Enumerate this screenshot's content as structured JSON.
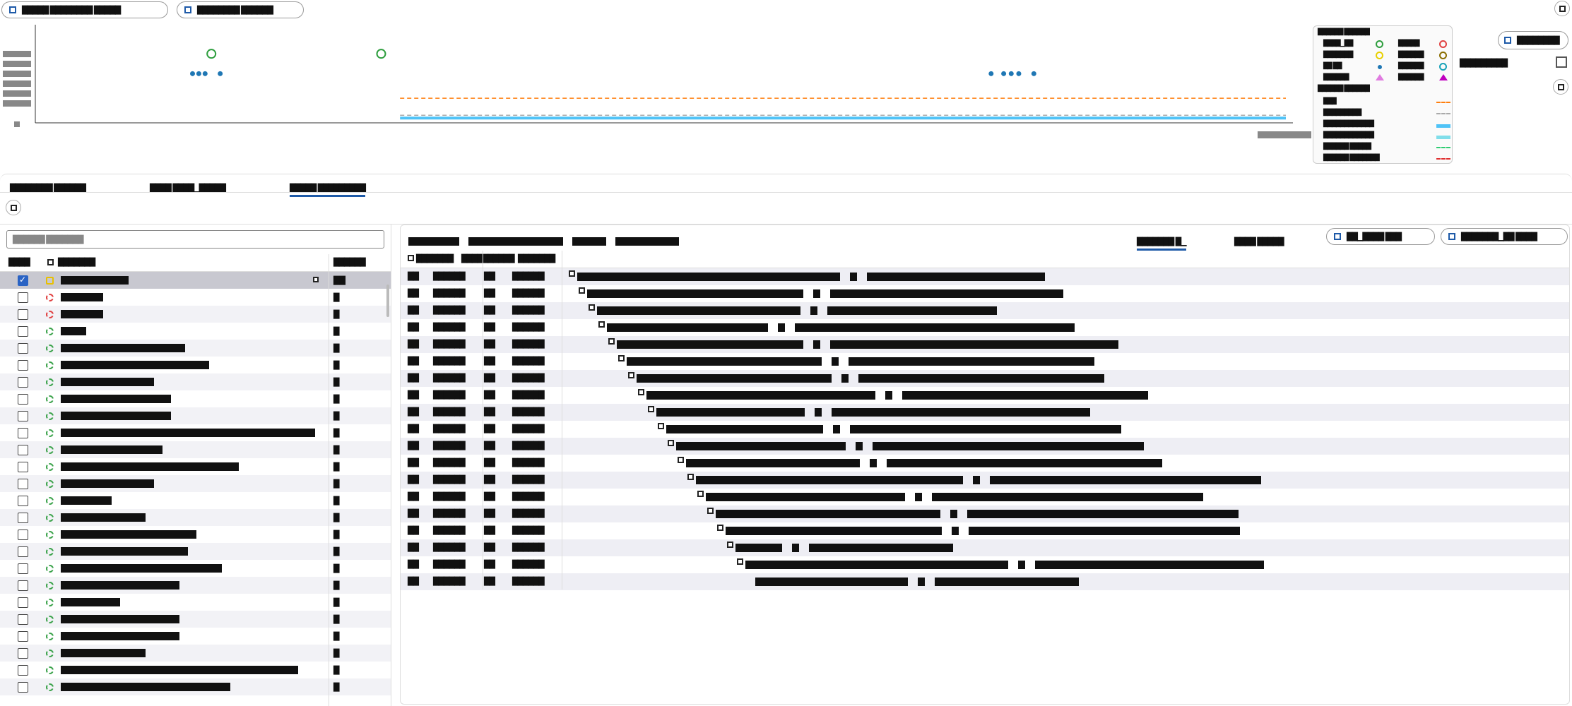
{
  "toolbar": {
    "left_pills": [
      {
        "label": "█████ ████████ █████"
      },
      {
        "label": "████████ ██████"
      }
    ],
    "right_pill": "████████",
    "select_value": "█████████"
  },
  "chart_data": {
    "type": "line",
    "xlabel": "",
    "ylabel": "",
    "ylim": [
      0,
      10
    ],
    "xlim": [
      0,
      100
    ],
    "grid": false,
    "legend_position": "right",
    "baseline_series": [
      {
        "name": "████",
        "style": "dashed",
        "color": "#ff7f0e",
        "values_flat": 2.6
      },
      {
        "name": "████████",
        "style": "dashed",
        "color": "#aaaaaa",
        "values_flat": 0.8
      },
      {
        "name": "████████",
        "style": "solid",
        "color": "#4fc3f7",
        "values_flat": 0.5
      }
    ],
    "markers": [
      {
        "x": 14,
        "y": 7.3,
        "shape": "circle-open",
        "color": "#2e9e3e"
      },
      {
        "x": 27.5,
        "y": 7.3,
        "shape": "circle-open",
        "color": "#2e9e3e"
      },
      {
        "x": 12.5,
        "y": 5.2,
        "shape": "dot",
        "color": "#1f77b4"
      },
      {
        "x": 13.0,
        "y": 5.2,
        "shape": "dot",
        "color": "#1f77b4"
      },
      {
        "x": 13.5,
        "y": 5.2,
        "shape": "dot",
        "color": "#1f77b4"
      },
      {
        "x": 14.7,
        "y": 5.2,
        "shape": "dot",
        "color": "#1f77b4"
      },
      {
        "x": 76.0,
        "y": 5.2,
        "shape": "dot",
        "color": "#1f77b4"
      },
      {
        "x": 77.0,
        "y": 5.2,
        "shape": "dot",
        "color": "#1f77b4"
      },
      {
        "x": 77.6,
        "y": 5.2,
        "shape": "dot",
        "color": "#1f77b4"
      },
      {
        "x": 78.2,
        "y": 5.2,
        "shape": "dot",
        "color": "#1f77b4"
      },
      {
        "x": 79.4,
        "y": 5.2,
        "shape": "dot",
        "color": "#1f77b4"
      }
    ]
  },
  "legend": {
    "title": "██████ ██████",
    "marker_rows": [
      {
        "a": "████▁██",
        "a_color": "#2e9e3e",
        "a_shape": "circle",
        "b": "█████",
        "b_color": "#e04040",
        "b_shape": "circle"
      },
      {
        "a": "███████",
        "a_color": "#e8d000",
        "a_shape": "circle",
        "b": "██████",
        "b_color": "#8b6d00",
        "b_shape": "circle"
      },
      {
        "a": "██ ██",
        "a_color": "#1f77b4",
        "a_shape": "dot",
        "b": "██████",
        "b_color": "#17a2b8",
        "b_shape": "circle"
      },
      {
        "a": "██████",
        "a_color": "#e07be0",
        "a_shape": "triangle",
        "b": "██████",
        "b_color": "#c000c0",
        "b_shape": "triangle"
      }
    ],
    "line_title": "██████ ██████",
    "line_rows": [
      {
        "label": "███",
        "color": "#ff7f0e",
        "dash": true
      },
      {
        "label": "█████████",
        "color": "#aaaaaa",
        "dash": true
      },
      {
        "label": "████████████",
        "color": "#4fc3f7",
        "dash": false,
        "thick": true
      },
      {
        "label": "████████████",
        "color": "#80deea",
        "dash": false,
        "thick": true
      },
      {
        "label": "██████ █████",
        "color": "#2ecc71",
        "dash": true
      },
      {
        "label": "██████ ███████",
        "color": "#e03030",
        "dash": true
      }
    ]
  },
  "tabs": [
    {
      "label": "████████ ██████",
      "active": false
    },
    {
      "label": "████ ████▁█████",
      "active": false
    },
    {
      "label": "█████ █████████",
      "active": true
    }
  ],
  "left": {
    "search_placeholder": "██████ ███████",
    "headers": [
      "████",
      "███████",
      "██████"
    ],
    "rows": [
      {
        "checked": true,
        "status": "yellow",
        "name_w": 96,
        "val": "██",
        "selected": true
      },
      {
        "checked": false,
        "status": "red",
        "name_w": 60,
        "val": "█"
      },
      {
        "checked": false,
        "status": "red",
        "name_w": 60,
        "val": "█"
      },
      {
        "checked": false,
        "status": "green",
        "name_w": 36,
        "val": "█"
      },
      {
        "checked": false,
        "status": "green",
        "name_w": 176,
        "val": "█"
      },
      {
        "checked": false,
        "status": "green",
        "name_w": 210,
        "val": "█"
      },
      {
        "checked": false,
        "status": "green",
        "name_w": 132,
        "val": "█"
      },
      {
        "checked": false,
        "status": "green",
        "name_w": 156,
        "val": "█"
      },
      {
        "checked": false,
        "status": "green",
        "name_w": 156,
        "val": "█"
      },
      {
        "checked": false,
        "status": "green",
        "name_w": 360,
        "val": "█"
      },
      {
        "checked": false,
        "status": "green",
        "name_w": 144,
        "val": "█"
      },
      {
        "checked": false,
        "status": "green",
        "name_w": 252,
        "val": "█"
      },
      {
        "checked": false,
        "status": "green",
        "name_w": 132,
        "val": "█"
      },
      {
        "checked": false,
        "status": "green",
        "name_w": 72,
        "val": "█"
      },
      {
        "checked": false,
        "status": "green",
        "name_w": 120,
        "val": "█"
      },
      {
        "checked": false,
        "status": "green",
        "name_w": 192,
        "val": "█"
      },
      {
        "checked": false,
        "status": "green",
        "name_w": 180,
        "val": "█"
      },
      {
        "checked": false,
        "status": "green",
        "name_w": 228,
        "val": "█"
      },
      {
        "checked": false,
        "status": "green",
        "name_w": 168,
        "val": "█"
      },
      {
        "checked": false,
        "status": "green",
        "name_w": 84,
        "val": "█"
      },
      {
        "checked": false,
        "status": "green",
        "name_w": 168,
        "val": "█"
      },
      {
        "checked": false,
        "status": "green",
        "name_w": 168,
        "val": "█"
      },
      {
        "checked": false,
        "status": "green",
        "name_w": 120,
        "val": "█"
      },
      {
        "checked": false,
        "status": "green",
        "name_w": 336,
        "val": "█"
      },
      {
        "checked": false,
        "status": "green",
        "name_w": 240,
        "val": "█"
      }
    ]
  },
  "right": {
    "tabs": [
      {
        "label": "███████ █▁",
        "active": true
      },
      {
        "label": "████ █████",
        "active": false
      }
    ],
    "buttons": [
      "██▁████ ███",
      "███████▁██ ████"
    ],
    "headers": [
      "███████",
      "██████████",
      "███████"
    ],
    "rows": [
      {
        "indent": 0,
        "w1": 372,
        "w2": 252
      },
      {
        "indent": 1,
        "w1": 306,
        "w2": 330
      },
      {
        "indent": 2,
        "w1": 288,
        "w2": 240
      },
      {
        "indent": 3,
        "w1": 228,
        "w2": 396
      },
      {
        "indent": 4,
        "w1": 264,
        "w2": 408
      },
      {
        "indent": 5,
        "w1": 276,
        "w2": 348
      },
      {
        "indent": 6,
        "w1": 276,
        "w2": 348
      },
      {
        "indent": 7,
        "w1": 324,
        "w2": 348
      },
      {
        "indent": 8,
        "w1": 210,
        "w2": 366
      },
      {
        "indent": 9,
        "w1": 222,
        "w2": 384
      },
      {
        "indent": 10,
        "w1": 240,
        "w2": 384
      },
      {
        "indent": 11,
        "w1": 246,
        "w2": 390
      },
      {
        "indent": 12,
        "w1": 378,
        "w2": 384
      },
      {
        "indent": 13,
        "w1": 282,
        "w2": 384
      },
      {
        "indent": 14,
        "w1": 318,
        "w2": 384
      },
      {
        "indent": 15,
        "w1": 306,
        "w2": 384
      },
      {
        "indent": 16,
        "w1": 66,
        "w2": 204
      },
      {
        "indent": 17,
        "w1": 372,
        "w2": 324
      },
      {
        "indent": 18,
        "w1": 216,
        "w2": 204
      }
    ],
    "row_cells": [
      "██",
      "██████",
      "██",
      "██████"
    ]
  }
}
